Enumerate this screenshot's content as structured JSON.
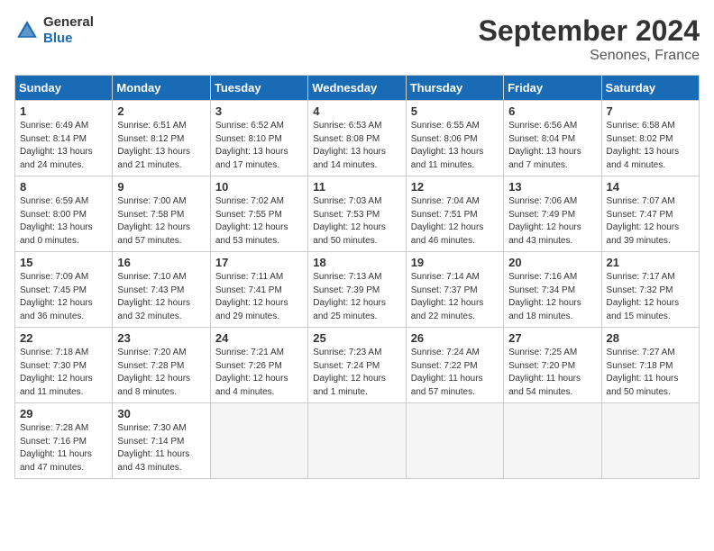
{
  "logo": {
    "line1": "General",
    "line2": "Blue"
  },
  "title": "September 2024",
  "location": "Senones, France",
  "weekdays": [
    "Sunday",
    "Monday",
    "Tuesday",
    "Wednesday",
    "Thursday",
    "Friday",
    "Saturday"
  ],
  "weeks": [
    [
      {
        "day": "1",
        "info": "Sunrise: 6:49 AM\nSunset: 8:14 PM\nDaylight: 13 hours\nand 24 minutes."
      },
      {
        "day": "2",
        "info": "Sunrise: 6:51 AM\nSunset: 8:12 PM\nDaylight: 13 hours\nand 21 minutes."
      },
      {
        "day": "3",
        "info": "Sunrise: 6:52 AM\nSunset: 8:10 PM\nDaylight: 13 hours\nand 17 minutes."
      },
      {
        "day": "4",
        "info": "Sunrise: 6:53 AM\nSunset: 8:08 PM\nDaylight: 13 hours\nand 14 minutes."
      },
      {
        "day": "5",
        "info": "Sunrise: 6:55 AM\nSunset: 8:06 PM\nDaylight: 13 hours\nand 11 minutes."
      },
      {
        "day": "6",
        "info": "Sunrise: 6:56 AM\nSunset: 8:04 PM\nDaylight: 13 hours\nand 7 minutes."
      },
      {
        "day": "7",
        "info": "Sunrise: 6:58 AM\nSunset: 8:02 PM\nDaylight: 13 hours\nand 4 minutes."
      }
    ],
    [
      {
        "day": "8",
        "info": "Sunrise: 6:59 AM\nSunset: 8:00 PM\nDaylight: 13 hours\nand 0 minutes."
      },
      {
        "day": "9",
        "info": "Sunrise: 7:00 AM\nSunset: 7:58 PM\nDaylight: 12 hours\nand 57 minutes."
      },
      {
        "day": "10",
        "info": "Sunrise: 7:02 AM\nSunset: 7:55 PM\nDaylight: 12 hours\nand 53 minutes."
      },
      {
        "day": "11",
        "info": "Sunrise: 7:03 AM\nSunset: 7:53 PM\nDaylight: 12 hours\nand 50 minutes."
      },
      {
        "day": "12",
        "info": "Sunrise: 7:04 AM\nSunset: 7:51 PM\nDaylight: 12 hours\nand 46 minutes."
      },
      {
        "day": "13",
        "info": "Sunrise: 7:06 AM\nSunset: 7:49 PM\nDaylight: 12 hours\nand 43 minutes."
      },
      {
        "day": "14",
        "info": "Sunrise: 7:07 AM\nSunset: 7:47 PM\nDaylight: 12 hours\nand 39 minutes."
      }
    ],
    [
      {
        "day": "15",
        "info": "Sunrise: 7:09 AM\nSunset: 7:45 PM\nDaylight: 12 hours\nand 36 minutes."
      },
      {
        "day": "16",
        "info": "Sunrise: 7:10 AM\nSunset: 7:43 PM\nDaylight: 12 hours\nand 32 minutes."
      },
      {
        "day": "17",
        "info": "Sunrise: 7:11 AM\nSunset: 7:41 PM\nDaylight: 12 hours\nand 29 minutes."
      },
      {
        "day": "18",
        "info": "Sunrise: 7:13 AM\nSunset: 7:39 PM\nDaylight: 12 hours\nand 25 minutes."
      },
      {
        "day": "19",
        "info": "Sunrise: 7:14 AM\nSunset: 7:37 PM\nDaylight: 12 hours\nand 22 minutes."
      },
      {
        "day": "20",
        "info": "Sunrise: 7:16 AM\nSunset: 7:34 PM\nDaylight: 12 hours\nand 18 minutes."
      },
      {
        "day": "21",
        "info": "Sunrise: 7:17 AM\nSunset: 7:32 PM\nDaylight: 12 hours\nand 15 minutes."
      }
    ],
    [
      {
        "day": "22",
        "info": "Sunrise: 7:18 AM\nSunset: 7:30 PM\nDaylight: 12 hours\nand 11 minutes."
      },
      {
        "day": "23",
        "info": "Sunrise: 7:20 AM\nSunset: 7:28 PM\nDaylight: 12 hours\nand 8 minutes."
      },
      {
        "day": "24",
        "info": "Sunrise: 7:21 AM\nSunset: 7:26 PM\nDaylight: 12 hours\nand 4 minutes."
      },
      {
        "day": "25",
        "info": "Sunrise: 7:23 AM\nSunset: 7:24 PM\nDaylight: 12 hours\nand 1 minute."
      },
      {
        "day": "26",
        "info": "Sunrise: 7:24 AM\nSunset: 7:22 PM\nDaylight: 11 hours\nand 57 minutes."
      },
      {
        "day": "27",
        "info": "Sunrise: 7:25 AM\nSunset: 7:20 PM\nDaylight: 11 hours\nand 54 minutes."
      },
      {
        "day": "28",
        "info": "Sunrise: 7:27 AM\nSunset: 7:18 PM\nDaylight: 11 hours\nand 50 minutes."
      }
    ],
    [
      {
        "day": "29",
        "info": "Sunrise: 7:28 AM\nSunset: 7:16 PM\nDaylight: 11 hours\nand 47 minutes."
      },
      {
        "day": "30",
        "info": "Sunrise: 7:30 AM\nSunset: 7:14 PM\nDaylight: 11 hours\nand 43 minutes."
      },
      {
        "day": "",
        "info": ""
      },
      {
        "day": "",
        "info": ""
      },
      {
        "day": "",
        "info": ""
      },
      {
        "day": "",
        "info": ""
      },
      {
        "day": "",
        "info": ""
      }
    ]
  ]
}
